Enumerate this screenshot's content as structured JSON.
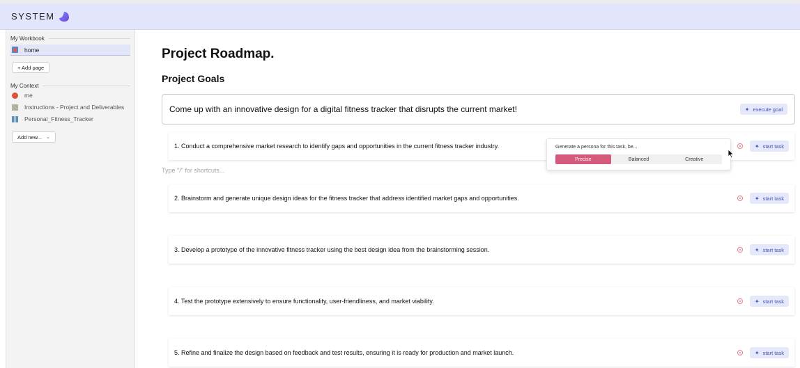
{
  "app": {
    "title": "SYSTEM"
  },
  "sidebar": {
    "workbook_heading": "My Workbook",
    "pages": [
      {
        "label": "home",
        "active": true
      }
    ],
    "add_page_label": "+ Add page",
    "context_heading": "My Context",
    "context_items": [
      {
        "label": "me",
        "icon": "person-avatar-icon"
      },
      {
        "label": "Instructions - Project and Deliverables",
        "icon": "document-thumbnail-icon"
      },
      {
        "label": "Personal_Fitness_Tracker",
        "icon": "dataset-thumbnail-icon"
      }
    ],
    "add_new_label": "Add new...",
    "add_new_chevron": "⌄"
  },
  "main": {
    "title": "Project Roadmap.",
    "goals_heading": "Project Goals",
    "goal": {
      "text": "Come up with an innovative design for a digital fitness tracker that disrupts the current market!",
      "action_label": "execute goal"
    },
    "shortcut_hint": "Type \"/\" for shortcuts...",
    "tasks": [
      {
        "text": "1. Conduct a comprehensive market research to identify gaps and opportunities in the current fitness tracker industry.",
        "action_label": "start task"
      },
      {
        "text": "2. Brainstorm and generate unique design ideas for the fitness tracker that address identified market gaps and opportunities.",
        "action_label": "start task"
      },
      {
        "text": "3. Develop a prototype of the innovative fitness tracker using the best design idea from the brainstorming session.",
        "action_label": "start task"
      },
      {
        "text": "4. Test the prototype extensively to ensure functionality, user-friendliness, and market viability.",
        "action_label": "start task"
      },
      {
        "text": "5. Refine and finalize the design based on feedback and test results, ensuring it is ready for production and market launch.",
        "action_label": "start task"
      }
    ],
    "persona_popover": {
      "label": "Generate a persona for this task, be...",
      "options": [
        "Precise",
        "Balanced",
        "Creative"
      ],
      "selected": "Precise"
    }
  },
  "colors": {
    "topbar_bg": "#e3e6fa",
    "accent": "#4253b0",
    "selected_option": "#d4597b",
    "warning": "#e57b89"
  }
}
